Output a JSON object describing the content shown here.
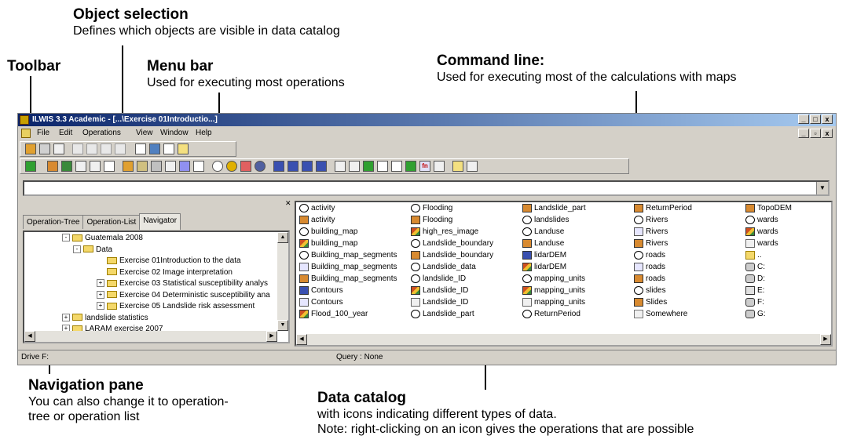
{
  "annotations": {
    "object_selection": {
      "title": "Object selection",
      "desc": "Defines which objects are visible in data catalog"
    },
    "toolbar": {
      "title": "Toolbar"
    },
    "menu_bar": {
      "title": "Menu bar",
      "desc": "Used for executing most operations"
    },
    "command_line": {
      "title": "Command line:",
      "desc": "Used for executing most of the calculations with maps"
    },
    "navigation_pane": {
      "title": "Navigation pane",
      "desc1": "You can also change it to operation-",
      "desc2": "tree or operation list"
    },
    "data_catalog": {
      "title": "Data catalog",
      "desc1": "with icons indicating different types of data.",
      "desc2": "Note: right-clicking on an icon gives the operations that are possible"
    }
  },
  "window": {
    "title": "ILWIS 3.3 Academic - [...\\Exercise 01Introductio...]",
    "title_buttons": [
      "_",
      "□",
      "x"
    ],
    "doc_buttons": [
      "_",
      "▫",
      "x"
    ]
  },
  "menu": [
    "File",
    "Edit",
    "Operations",
    "View",
    "Window",
    "Help"
  ],
  "command_line": {
    "value": ""
  },
  "nav": {
    "tabs": [
      "Operation-Tree",
      "Operation-List",
      "Navigator"
    ],
    "active_tab": "Navigator",
    "tree": [
      {
        "label": "Guatemala 2008",
        "level": 0,
        "toggle": "-"
      },
      {
        "label": "Data",
        "level": 1,
        "toggle": "-"
      },
      {
        "label": "Exercise 01Introduction to the data",
        "level": 2,
        "toggle": ""
      },
      {
        "label": "Exercise 02 Image interpretation",
        "level": 2,
        "toggle": ""
      },
      {
        "label": "Exercise 03 Statistical susceptibility analys",
        "level": 2,
        "toggle": "+"
      },
      {
        "label": "Exercise 04 Deterministic susceptibility ana",
        "level": 2,
        "toggle": "+"
      },
      {
        "label": "Exercise 05 Landslide risk assessment",
        "level": 2,
        "toggle": "+"
      },
      {
        "label": "landslide statistics",
        "level": 0,
        "toggle": "+"
      },
      {
        "label": "LARAM exercise 2007",
        "level": 0,
        "toggle": "+"
      }
    ]
  },
  "catalog": {
    "columns": [
      [
        {
          "name": "activity",
          "icon": "mpl"
        },
        {
          "name": "activity",
          "icon": "tbl"
        },
        {
          "name": "building_map",
          "icon": "mpl"
        },
        {
          "name": "building_map",
          "icon": "rst"
        },
        {
          "name": "Building_map_segments",
          "icon": "mpl"
        },
        {
          "name": "Building_map_segments",
          "icon": "seg"
        },
        {
          "name": "Building_map_segments",
          "icon": "tbl"
        },
        {
          "name": "Contours",
          "icon": "dem"
        },
        {
          "name": "Contours",
          "icon": "seg"
        },
        {
          "name": "Flood_100_year",
          "icon": "rst"
        }
      ],
      [
        {
          "name": "Flooding",
          "icon": "mpl"
        },
        {
          "name": "Flooding",
          "icon": "tbl"
        },
        {
          "name": "high_res_image",
          "icon": "rst"
        },
        {
          "name": "Landslide_boundary",
          "icon": "mpl"
        },
        {
          "name": "Landslide_boundary",
          "icon": "tbl"
        },
        {
          "name": "Landslide_data",
          "icon": "mpl"
        },
        {
          "name": "landslide_ID",
          "icon": "mpl"
        },
        {
          "name": "Landslide_ID",
          "icon": "rst"
        },
        {
          "name": "Landslide_ID",
          "icon": "dom"
        },
        {
          "name": "Landslide_part",
          "icon": "mpl"
        }
      ],
      [
        {
          "name": "Landslide_part",
          "icon": "tbl"
        },
        {
          "name": "landslides",
          "icon": "mpl"
        },
        {
          "name": "Landuse",
          "icon": "mpl"
        },
        {
          "name": "Landuse",
          "icon": "tbl"
        },
        {
          "name": "lidarDEM",
          "icon": "dem"
        },
        {
          "name": "lidarDEM",
          "icon": "rst"
        },
        {
          "name": "mapping_units",
          "icon": "mpl"
        },
        {
          "name": "mapping_units",
          "icon": "rst"
        },
        {
          "name": "mapping_units",
          "icon": "dom"
        },
        {
          "name": "ReturnPeriod",
          "icon": "mpl"
        }
      ],
      [
        {
          "name": "ReturnPeriod",
          "icon": "tbl"
        },
        {
          "name": "Rivers",
          "icon": "mpl"
        },
        {
          "name": "Rivers",
          "icon": "seg"
        },
        {
          "name": "Rivers",
          "icon": "tbl"
        },
        {
          "name": "roads",
          "icon": "mpl"
        },
        {
          "name": "roads",
          "icon": "seg"
        },
        {
          "name": "roads",
          "icon": "tbl"
        },
        {
          "name": "slides",
          "icon": "mpl"
        },
        {
          "name": "Slides",
          "icon": "tbl"
        },
        {
          "name": "Somewhere",
          "icon": "rpr"
        }
      ],
      [
        {
          "name": "TopoDEM",
          "icon": "tbl"
        },
        {
          "name": "wards",
          "icon": "mpl"
        },
        {
          "name": "wards",
          "icon": "rst"
        },
        {
          "name": "wards",
          "icon": "dom"
        },
        {
          "name": "..",
          "icon": "fld"
        },
        {
          "name": "C:",
          "icon": "drv"
        },
        {
          "name": "D:",
          "icon": "drv"
        },
        {
          "name": "E:",
          "icon": "prn"
        },
        {
          "name": "F:",
          "icon": "drv"
        },
        {
          "name": "G:",
          "icon": "drv"
        }
      ]
    ]
  },
  "status": {
    "left": "Drive F:",
    "query": "Query : None"
  }
}
